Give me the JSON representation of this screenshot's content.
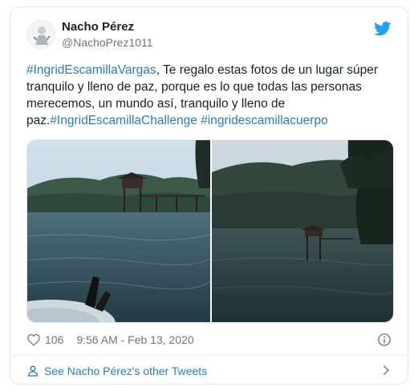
{
  "tweet": {
    "author_name": "Nacho Pérez",
    "author_handle": "@NachoPrez1011",
    "text_parts": {
      "hashtag1": "#IngridEscamillaVargas",
      "body": ", Te regalo estas fotos de un lugar súper tranquilo y lleno de paz, porque es lo que todas las personas merecemos, un mundo así, tranquilo y lleno de paz.",
      "hashtag2": "#IngridEscamillaChallenge",
      "hashtag3": "#ingridescamillacuerpo"
    },
    "likes": "106",
    "timestamp": "9:56 AM - Feb 13, 2020"
  },
  "footer": {
    "label": "See Nacho Pérez's other Tweets"
  },
  "colors": {
    "link": "#2b7bb9",
    "twitter_blue": "#1da1f2",
    "muted": "#697882",
    "border": "#e1e8ed"
  },
  "icons": {
    "brand": "twitter-bird-icon",
    "like": "heart-icon",
    "info": "info-icon",
    "footer": "person-icon",
    "footer_arrow": "chevron-right-icon"
  }
}
